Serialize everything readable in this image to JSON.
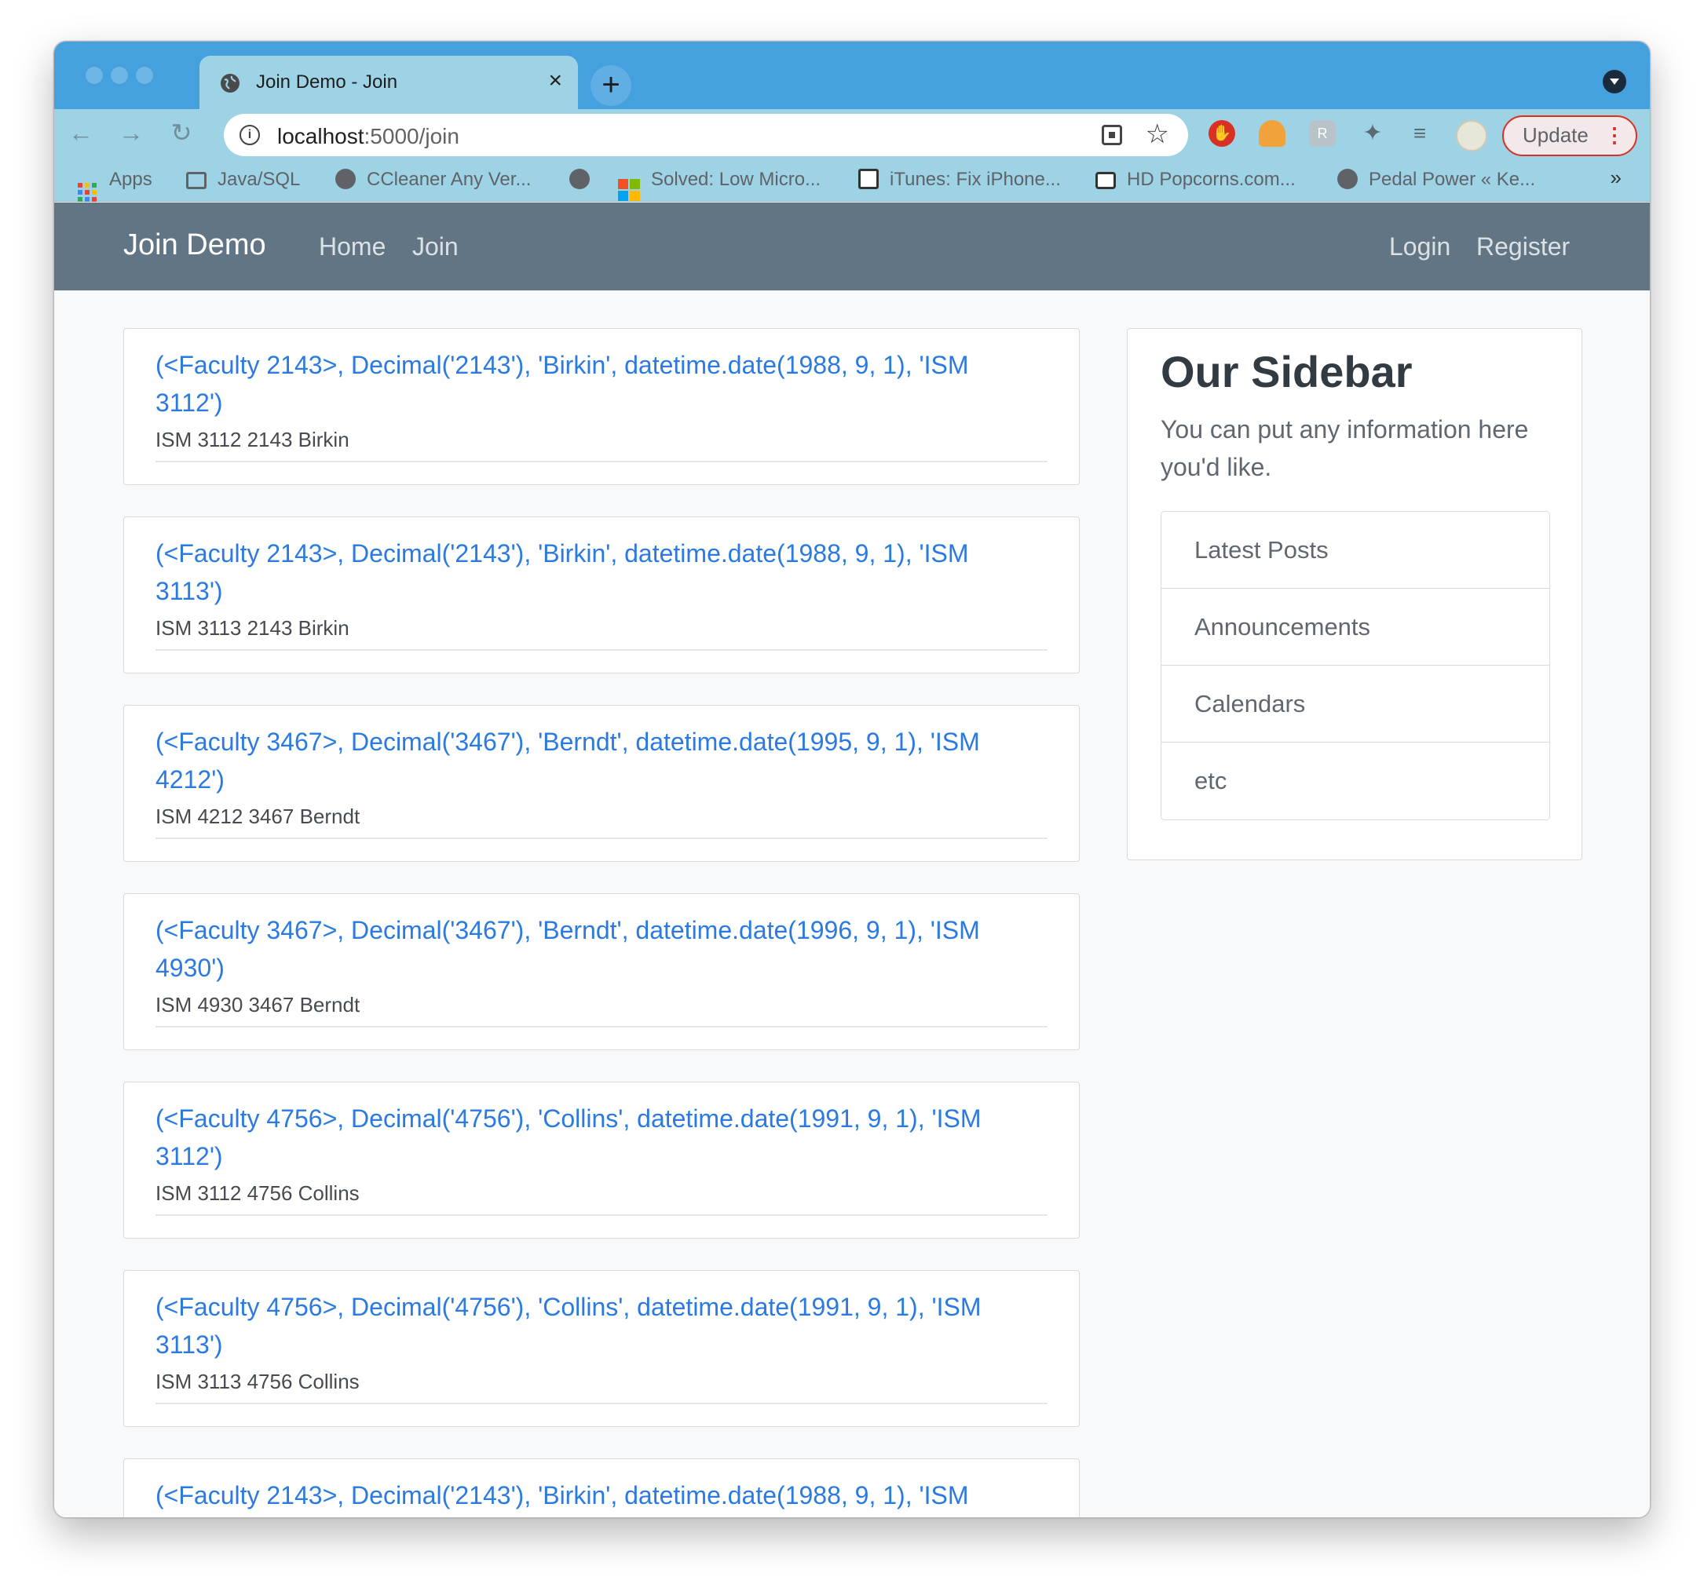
{
  "browser": {
    "tab_title": "Join Demo - Join",
    "tab_close": "×",
    "new_tab": "+",
    "url_host": "localhost",
    "url_path": ":5000/join",
    "update_label": "Update",
    "update_menu": "⋮",
    "bookmarks_more": "»",
    "bookmarks": [
      {
        "label": "Apps",
        "icon": "apps-grid-icon"
      },
      {
        "label": "Java/SQL",
        "icon": "folder-icon"
      },
      {
        "label": "CCleaner Any Ver...",
        "icon": "globe-icon"
      },
      {
        "label": "",
        "icon": "globe-icon"
      },
      {
        "label": "Solved: Low Micro...",
        "icon": "microsoft-icon"
      },
      {
        "label": "iTunes: Fix iPhone...",
        "icon": "magnifier-icon"
      },
      {
        "label": "HD Popcorns.com...",
        "icon": "tv-icon"
      },
      {
        "label": "Pedal Power « Ke...",
        "icon": "globe-icon"
      }
    ],
    "colors": {
      "tabstrip": "#45a0de",
      "toolbar": "#9ed3e6",
      "update_border": "#d93025"
    }
  },
  "site": {
    "brand": "Join Demo",
    "nav_left": [
      "Home",
      "Join"
    ],
    "nav_right": [
      "Login",
      "Register"
    ],
    "colors": {
      "navbar": "#627584",
      "link": "#2a7ae2"
    }
  },
  "posts": [
    {
      "title": "(<Faculty 2143>, Decimal('2143'), 'Birkin', datetime.date(1988, 9, 1), 'ISM 3112')",
      "meta": "ISM 3112 2143 Birkin"
    },
    {
      "title": "(<Faculty 2143>, Decimal('2143'), 'Birkin', datetime.date(1988, 9, 1), 'ISM 3113')",
      "meta": "ISM 3113 2143 Birkin"
    },
    {
      "title": "(<Faculty 3467>, Decimal('3467'), 'Berndt', datetime.date(1995, 9, 1), 'ISM 4212')",
      "meta": "ISM 4212 3467 Berndt"
    },
    {
      "title": "(<Faculty 3467>, Decimal('3467'), 'Berndt', datetime.date(1996, 9, 1), 'ISM 4930')",
      "meta": "ISM 4930 3467 Berndt"
    },
    {
      "title": "(<Faculty 4756>, Decimal('4756'), 'Collins', datetime.date(1991, 9, 1), 'ISM 3112')",
      "meta": "ISM 3112 4756 Collins"
    },
    {
      "title": "(<Faculty 4756>, Decimal('4756'), 'Collins', datetime.date(1991, 9, 1), 'ISM 3113')",
      "meta": "ISM 3113 4756 Collins"
    },
    {
      "title": "(<Faculty 2143>, Decimal('2143'), 'Birkin', datetime.date(1988, 9, 1), 'ISM",
      "meta": ""
    }
  ],
  "sidebar": {
    "title": "Our Sidebar",
    "text": "You can put any information here you'd like.",
    "items": [
      "Latest Posts",
      "Announcements",
      "Calendars",
      "etc"
    ]
  }
}
